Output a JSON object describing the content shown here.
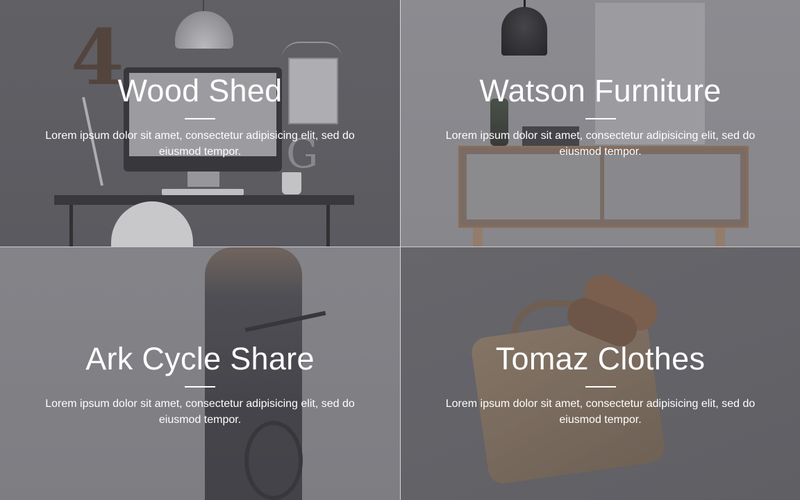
{
  "portfolio": {
    "items": [
      {
        "title": "Wood Shed",
        "description": "Lorem ipsum dolor sit amet, consectetur adipisicing elit, sed do eiusmod tempor."
      },
      {
        "title": "Watson Furniture",
        "description": "Lorem ipsum dolor sit amet, consectetur adipisicing elit, sed do eiusmod tempor."
      },
      {
        "title": "Ark Cycle Share",
        "description": "Lorem ipsum dolor sit amet, consectetur adipisicing elit, sed do eiusmod tempor."
      },
      {
        "title": "Tomaz Clothes",
        "description": "Lorem ipsum dolor sit amet, consectetur adipisicing elit, sed do eiusmod tempor."
      }
    ]
  },
  "colors": {
    "overlay": "#7a7a7f",
    "text": "#ffffff"
  }
}
